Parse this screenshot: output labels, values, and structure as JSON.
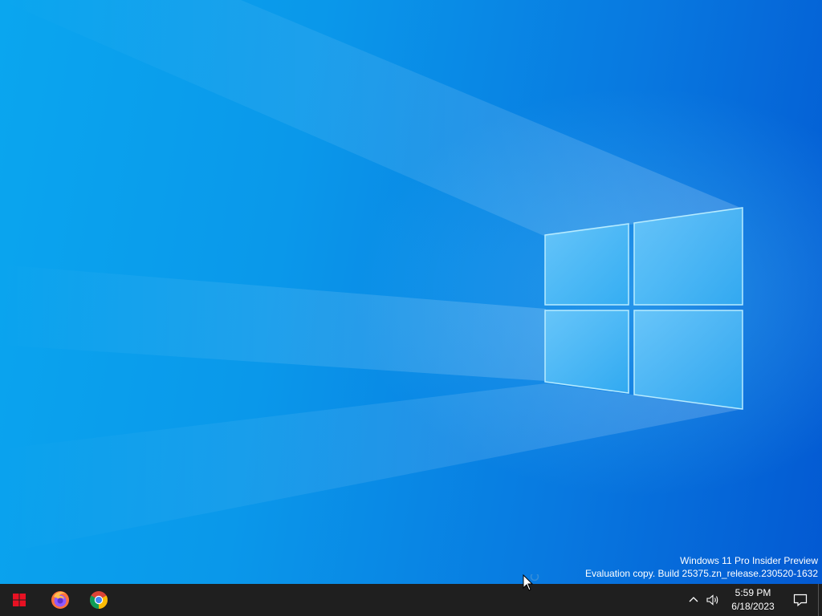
{
  "desktop": {
    "watermark": {
      "line1": "Windows 11 Pro Insider Preview",
      "line2": "Evaluation copy. Build 25375.zn_release.230520-1632"
    }
  },
  "taskbar": {
    "start_icon": "windows-logo-icon",
    "pinned_apps": [
      {
        "icon": "firefox-icon"
      },
      {
        "icon": "chrome-icon"
      }
    ],
    "tray": {
      "chevron_icon": "chevron-up-icon",
      "volume_icon": "volume-icon",
      "time": "5:59 PM",
      "date": "6/18/2023",
      "notification_icon": "action-center-icon"
    }
  },
  "colors": {
    "desktop_blue": "#0a98ea",
    "taskbar": "#1f1f1f",
    "start_red": "#e81123"
  }
}
